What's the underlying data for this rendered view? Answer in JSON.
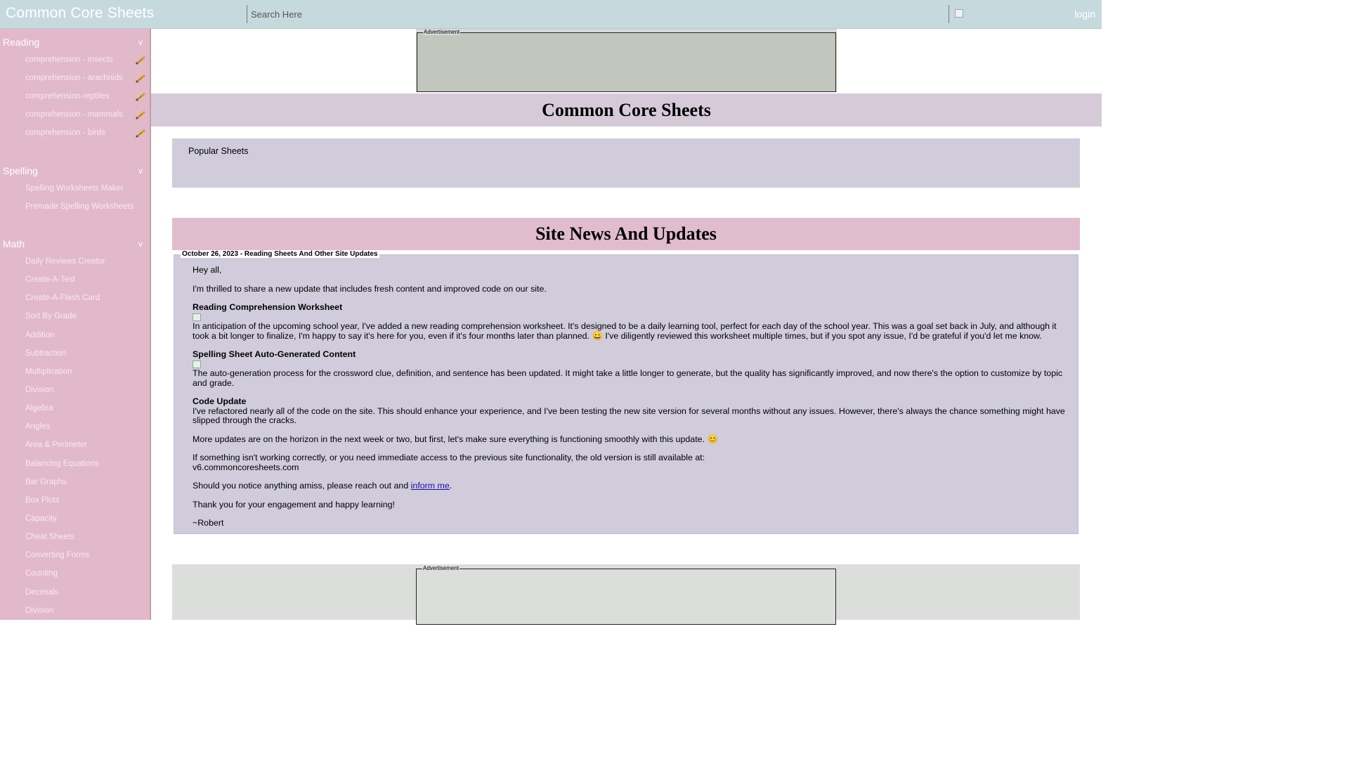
{
  "topbar": {
    "logo": "Common Core Sheets",
    "search_placeholder": "Search Here",
    "login_label": "login"
  },
  "sidebar": {
    "reading": {
      "title": "Reading",
      "chevron": "v",
      "items": [
        "comprehension - insects",
        "comprehension - arachnids",
        "comprehension-reptiles",
        "comprehension - mammals",
        "comprehension - birds"
      ],
      "item_icon": "pencil-icon"
    },
    "spelling": {
      "title": "Spelling",
      "chevron": "v",
      "items": [
        "Spelling Worksheets Maker",
        "Premade Spelling Worksheets"
      ]
    },
    "math": {
      "title": "Math",
      "chevron": "v",
      "items": [
        "Daily Reviews Creator",
        "Create-A-Test",
        "Create-A-Flash Card",
        "Sort By Grade",
        "Addition",
        "Subtraction",
        "Multiplication",
        "Division",
        "Algebra",
        "Angles",
        "Area & Perimeter",
        "Balancing Equations",
        "Bar Graphs",
        "Box Plots",
        "Capacity",
        "Cheat Sheets",
        "Converting Forms",
        "Counting",
        "Decimals",
        "Division"
      ]
    }
  },
  "ads": {
    "top_label": "Advertisement",
    "bottom_label": "Advertisement"
  },
  "main": {
    "title": "Common Core Sheets",
    "popular_label": "Popular Sheets",
    "news_title": "Site News And Updates",
    "news": {
      "legend": "October 26, 2023 - Reading Sheets And Other Site Updates",
      "greeting": "Hey all,",
      "intro": "I'm thrilled to share a new update that includes fresh content and improved code on our site.",
      "reading_head": "Reading Comprehension Worksheet",
      "reading_text_1": "In anticipation of the upcoming school year, I've added a new reading comprehension worksheet. It's designed to be a daily learning tool, perfect for each day of the school year. This was a goal set back in July, and although it took a bit longer to finalize, I'm happy to say it's here for you, even if it's four months later than planned.",
      "reading_emoji": "😄",
      "reading_text_2": "I've diligently reviewed this worksheet multiple times, but if you spot any issue, I'd be grateful if you'd let me know.",
      "spelling_head": "Spelling Sheet Auto-Generated Content",
      "spelling_text": "The auto-generation process for the crossword clue, definition, and sentence has been updated. It might take a little longer to generate, but the quality has significantly improved, and now there's the option to customize by topic and grade.",
      "code_head": "Code Update",
      "code_text": "I've refactored nearly all of the code on the site. This should enhance your experience, and I've been testing the new site version for several months without any issues. However, there's always the chance something might have slipped through the cracks.",
      "more_text": "More updates are on the horizon in the next week or two, but first, let's make sure everything is functioning smoothly with this update.",
      "more_emoji": "😊",
      "old_text": "If something isn't working correctly, or you need immediate access to the previous site functionality, the old version is still available at:",
      "old_url": "v6.commoncoresheets.com",
      "notice_text": "Should you notice anything amiss, please reach out and",
      "notice_link": "inform me",
      "notice_end": ".",
      "thanks": "Thank you for your engagement and happy learning!",
      "signoff": "~Robert"
    }
  },
  "colors": {
    "topbar": "#c6dade",
    "sidebar": "#e2b9c9",
    "title_band": "#d6cad9",
    "news_band": "#e0bccd",
    "content_box": "#d0ccdb",
    "link": "#1a0dab"
  }
}
